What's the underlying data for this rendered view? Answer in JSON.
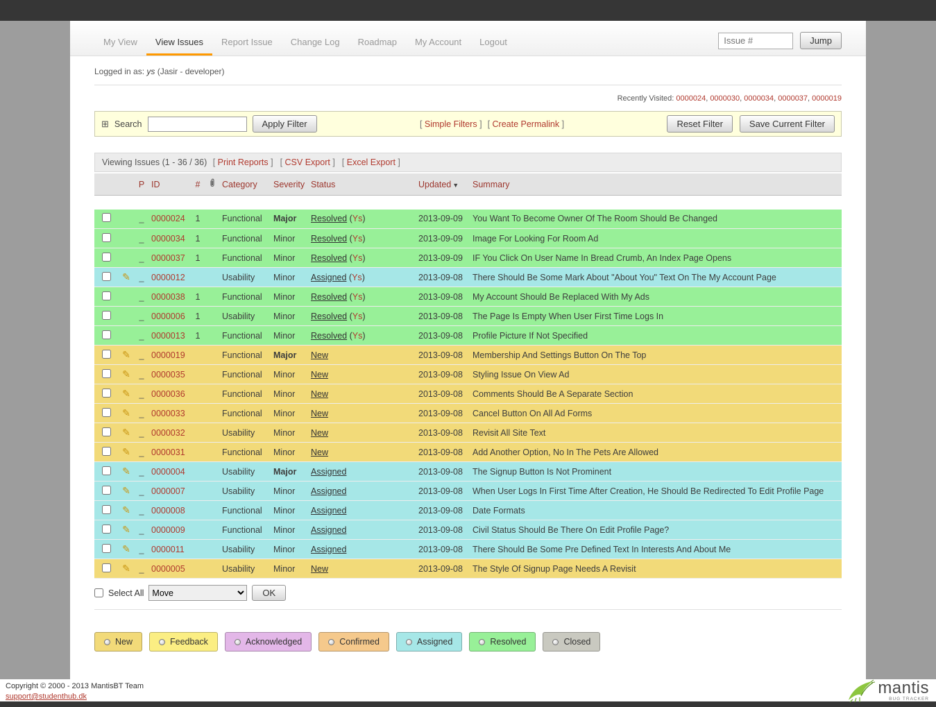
{
  "colors": {
    "accent_orange": "#ff9900",
    "link_red": "#b0392e",
    "header_link": "#9c352c",
    "filter_bg": "#ffffdd"
  },
  "status_colors": {
    "resolved": "#98f098",
    "assigned": "#a6e7e7",
    "new": "#f2da79"
  },
  "nav": {
    "items": [
      {
        "label": "My View",
        "active": false
      },
      {
        "label": "View Issues",
        "active": true
      },
      {
        "label": "Report Issue",
        "active": false
      },
      {
        "label": "Change Log",
        "active": false
      },
      {
        "label": "Roadmap",
        "active": false
      },
      {
        "label": "My Account",
        "active": false
      },
      {
        "label": "Logout",
        "active": false
      }
    ],
    "issue_placeholder": "Issue #",
    "jump_label": "Jump"
  },
  "login": {
    "prefix": "Logged in as:",
    "user": "ys",
    "detail": "(Jasir - developer)"
  },
  "recently_visited": {
    "label": "Recently Visited:",
    "ids": [
      "0000024",
      "0000030",
      "0000034",
      "0000037",
      "0000019"
    ]
  },
  "filter": {
    "expand_icon": "⊞",
    "search_label": "Search",
    "search_value": "",
    "apply": "Apply Filter",
    "links": [
      "Simple Filters",
      "Create Permalink"
    ],
    "reset": "Reset Filter",
    "save": "Save Current Filter"
  },
  "toolbar": {
    "viewing": "Viewing Issues (1 - 36 / 36)",
    "links": [
      "Print Reports",
      "CSV Export",
      "Excel Export"
    ]
  },
  "table": {
    "headers": {
      "p": "P",
      "id": "ID",
      "notes": "#",
      "category": "Category",
      "severity": "Severity",
      "status": "Status",
      "updated": "Updated",
      "summary": "Summary"
    },
    "rows": [
      {
        "edit": false,
        "p": "_",
        "id": "0000024",
        "notes": "1",
        "category": "Functional",
        "severity": "Major",
        "status": "Resolved",
        "handler": "Ys",
        "updated": "2013-09-09",
        "summary": "You Want To Become Owner Of The Room Should Be Changed",
        "color": "resolved"
      },
      {
        "edit": false,
        "p": "_",
        "id": "0000034",
        "notes": "1",
        "category": "Functional",
        "severity": "Minor",
        "status": "Resolved",
        "handler": "Ys",
        "updated": "2013-09-09",
        "summary": "Image For Looking For Room Ad",
        "color": "resolved"
      },
      {
        "edit": false,
        "p": "_",
        "id": "0000037",
        "notes": "1",
        "category": "Functional",
        "severity": "Minor",
        "status": "Resolved",
        "handler": "Ys",
        "updated": "2013-09-09",
        "summary": "IF You Click On User Name In Bread Crumb, An Index Page Opens",
        "color": "resolved"
      },
      {
        "edit": true,
        "p": "_",
        "id": "0000012",
        "notes": "",
        "category": "Usability",
        "severity": "Minor",
        "status": "Assigned",
        "handler": "Ys",
        "updated": "2013-09-08",
        "summary": "There Should Be Some Mark About \"About You\" Text On The My Account Page",
        "color": "assigned"
      },
      {
        "edit": false,
        "p": "_",
        "id": "0000038",
        "notes": "1",
        "category": "Functional",
        "severity": "Minor",
        "status": "Resolved",
        "handler": "Ys",
        "updated": "2013-09-08",
        "summary": "My Account Should Be Replaced With My Ads",
        "color": "resolved"
      },
      {
        "edit": false,
        "p": "_",
        "id": "0000006",
        "notes": "1",
        "category": "Usability",
        "severity": "Minor",
        "status": "Resolved",
        "handler": "Ys",
        "updated": "2013-09-08",
        "summary": "The Page Is Empty When User First Time Logs In",
        "color": "resolved"
      },
      {
        "edit": false,
        "p": "_",
        "id": "0000013",
        "notes": "1",
        "category": "Functional",
        "severity": "Minor",
        "status": "Resolved",
        "handler": "Ys",
        "updated": "2013-09-08",
        "summary": "Profile Picture If Not Specified",
        "color": "resolved"
      },
      {
        "edit": true,
        "p": "_",
        "id": "0000019",
        "notes": "",
        "category": "Functional",
        "severity": "Major",
        "status": "New",
        "handler": "",
        "updated": "2013-09-08",
        "summary": "Membership And Settings Button On The Top",
        "color": "new"
      },
      {
        "edit": true,
        "p": "_",
        "id": "0000035",
        "notes": "",
        "category": "Functional",
        "severity": "Minor",
        "status": "New",
        "handler": "",
        "updated": "2013-09-08",
        "summary": "Styling Issue On View Ad",
        "color": "new"
      },
      {
        "edit": true,
        "p": "_",
        "id": "0000036",
        "notes": "",
        "category": "Functional",
        "severity": "Minor",
        "status": "New",
        "handler": "",
        "updated": "2013-09-08",
        "summary": "Comments Should Be A Separate Section",
        "color": "new"
      },
      {
        "edit": true,
        "p": "_",
        "id": "0000033",
        "notes": "",
        "category": "Functional",
        "severity": "Minor",
        "status": "New",
        "handler": "",
        "updated": "2013-09-08",
        "summary": "Cancel Button On All Ad Forms",
        "color": "new"
      },
      {
        "edit": true,
        "p": "_",
        "id": "0000032",
        "notes": "",
        "category": "Usability",
        "severity": "Minor",
        "status": "New",
        "handler": "",
        "updated": "2013-09-08",
        "summary": "Revisit All Site Text",
        "color": "new"
      },
      {
        "edit": true,
        "p": "_",
        "id": "0000031",
        "notes": "",
        "category": "Functional",
        "severity": "Minor",
        "status": "New",
        "handler": "",
        "updated": "2013-09-08",
        "summary": "Add Another Option, No In The Pets Are Allowed",
        "color": "new"
      },
      {
        "edit": true,
        "p": "_",
        "id": "0000004",
        "notes": "",
        "category": "Usability",
        "severity": "Major",
        "status": "Assigned",
        "handler": "",
        "updated": "2013-09-08",
        "summary": "The Signup Button Is Not Prominent",
        "color": "assigned"
      },
      {
        "edit": true,
        "p": "_",
        "id": "0000007",
        "notes": "",
        "category": "Usability",
        "severity": "Minor",
        "status": "Assigned",
        "handler": "",
        "updated": "2013-09-08",
        "summary": "When User Logs In First Time After Creation, He Should Be Redirected To Edit Profile Page",
        "color": "assigned"
      },
      {
        "edit": true,
        "p": "_",
        "id": "0000008",
        "notes": "",
        "category": "Functional",
        "severity": "Minor",
        "status": "Assigned",
        "handler": "",
        "updated": "2013-09-08",
        "summary": "Date Formats",
        "color": "assigned"
      },
      {
        "edit": true,
        "p": "_",
        "id": "0000009",
        "notes": "",
        "category": "Functional",
        "severity": "Minor",
        "status": "Assigned",
        "handler": "",
        "updated": "2013-09-08",
        "summary": "Civil Status Should Be There On Edit Profile Page?",
        "color": "assigned"
      },
      {
        "edit": true,
        "p": "_",
        "id": "0000011",
        "notes": "",
        "category": "Usability",
        "severity": "Minor",
        "status": "Assigned",
        "handler": "",
        "updated": "2013-09-08",
        "summary": "There Should Be Some Pre Defined Text In Interests And About Me",
        "color": "assigned"
      },
      {
        "edit": true,
        "p": "_",
        "id": "0000005",
        "notes": "",
        "category": "Usability",
        "severity": "Minor",
        "status": "New",
        "handler": "",
        "updated": "2013-09-08",
        "summary": "The Style Of Signup Page Needs A Revisit",
        "color": "new"
      }
    ]
  },
  "bulk": {
    "select_all": "Select All",
    "action": "Move",
    "ok": "OK"
  },
  "legend": [
    {
      "label": "New",
      "color": "#f2da79"
    },
    {
      "label": "Feedback",
      "color": "#fbee83"
    },
    {
      "label": "Acknowledged",
      "color": "#e3b7e8"
    },
    {
      "label": "Confirmed",
      "color": "#f5c98c"
    },
    {
      "label": "Assigned",
      "color": "#a6e7e7"
    },
    {
      "label": "Resolved",
      "color": "#98f098"
    },
    {
      "label": "Closed",
      "color": "#c9c9c0"
    }
  ],
  "footer": {
    "copyright": "Copyright © 2000 - 2013 MantisBT Team",
    "email": "support@studenthub.dk",
    "logo_text": "mantis",
    "logo_sub": "BUG TRACKER"
  }
}
